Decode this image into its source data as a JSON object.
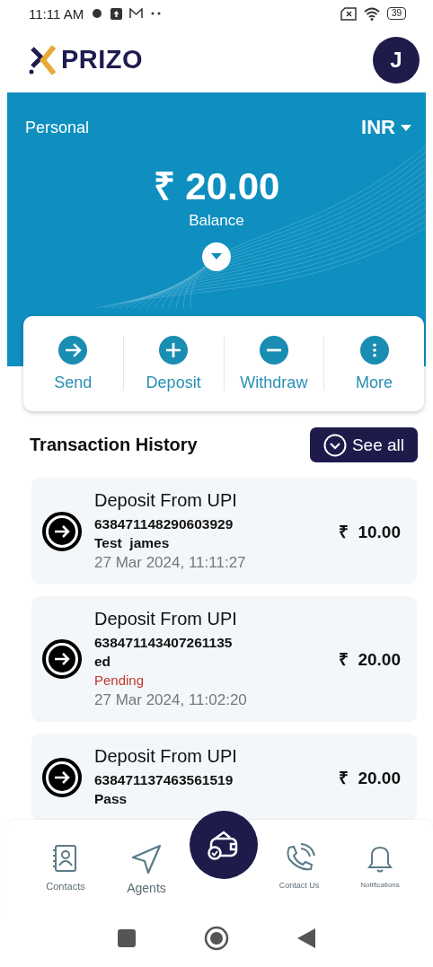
{
  "status_bar": {
    "time": "11:11 AM",
    "battery": "39"
  },
  "header": {
    "logo": "PRIZO",
    "avatar": "J"
  },
  "balance": {
    "account": "Personal",
    "currency": "INR",
    "amount": "₹ 20.00",
    "label": "Balance"
  },
  "actions": [
    {
      "label": "Send",
      "kind": "send"
    },
    {
      "label": "Deposit",
      "kind": "deposit"
    },
    {
      "label": "Withdraw",
      "kind": "withdraw"
    },
    {
      "label": "More",
      "kind": "more"
    }
  ],
  "history": {
    "title": "Transaction History",
    "see_all": "See all"
  },
  "transactions": [
    {
      "title": "Deposit From UPI",
      "reference": "638471148290603929",
      "name": "Test  james",
      "date": "27 Mar 2024, 11:11:27",
      "amount": "₹  10.00"
    },
    {
      "title": "Deposit From UPI",
      "reference": "638471143407261135",
      "name": "ed",
      "status": "Pending",
      "date": "27 Mar 2024, 11:02:20",
      "amount": "₹  20.00"
    },
    {
      "title": "Deposit From UPI",
      "reference": "638471137463561519",
      "name": "Pass",
      "amount": "₹  20.00"
    }
  ],
  "bottom_nav": [
    {
      "label": "Contacts",
      "kind": "contacts"
    },
    {
      "label": "Agents",
      "kind": "agents"
    },
    {
      "label": "Contact Us",
      "kind": "phone"
    },
    {
      "label": "Notifications",
      "kind": "bell"
    }
  ]
}
